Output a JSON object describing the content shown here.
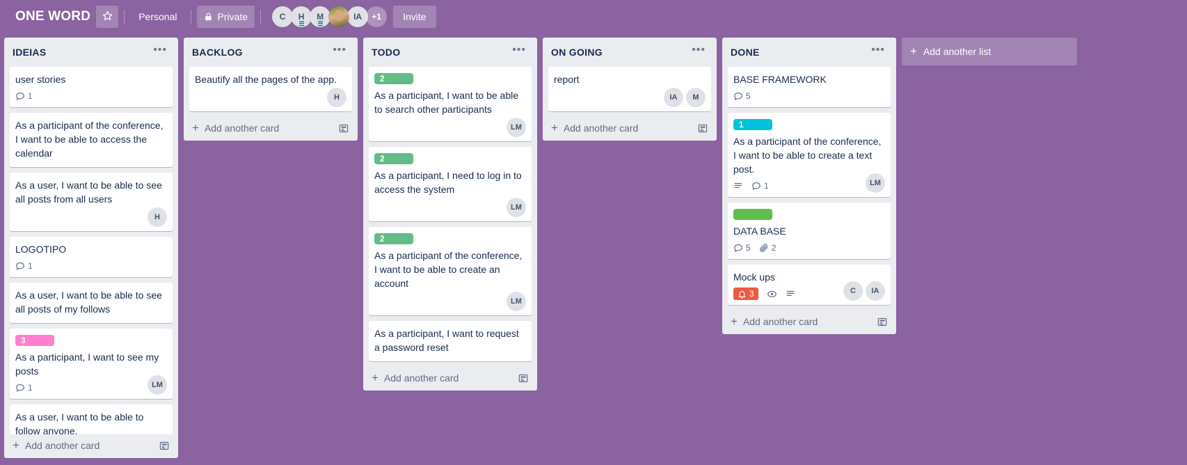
{
  "topbar": {
    "board_title": "ONE WORD",
    "star_icon": "star-icon",
    "workspace": "Personal",
    "visibility": "Private",
    "lock_icon": "lock-icon",
    "invite_label": "Invite",
    "members": [
      {
        "initials": "C",
        "type": "initials",
        "wave": false
      },
      {
        "initials": "H",
        "type": "initials",
        "wave": true
      },
      {
        "initials": "M",
        "type": "initials",
        "wave": true
      },
      {
        "initials": "",
        "type": "photo",
        "wave": false
      },
      {
        "initials": "IA",
        "type": "initials",
        "wave": false
      },
      {
        "initials": "+1",
        "type": "more",
        "wave": false
      }
    ]
  },
  "board": {
    "add_list_label": "Add another list",
    "add_card_label": "Add another card",
    "list_menu_glyph": "•••",
    "lists": [
      {
        "title": "IDEIAS",
        "cards": [
          {
            "title": "user stories",
            "labels": [],
            "comments": "1",
            "members": []
          },
          {
            "title": "As a participant of the conference, I want to be able to access the calendar",
            "labels": [],
            "members": []
          },
          {
            "title": "As a user, I want to be able to see all posts from all users",
            "labels": [],
            "members": [
              "H"
            ]
          },
          {
            "title": "LOGOTIPO",
            "labels": [],
            "comments": "1",
            "members": []
          },
          {
            "title": "As a user, I want to be able to see all posts of my follows",
            "labels": [],
            "members": []
          },
          {
            "title": "As a participant, I want to see my posts",
            "labels": [
              {
                "text": "3",
                "color": "#ff80ce"
              }
            ],
            "comments": "1",
            "members": [
              "LM"
            ]
          },
          {
            "title": "As a user, I want to be able to follow anyone.",
            "labels": [],
            "members": []
          }
        ]
      },
      {
        "title": "BACKLOG",
        "cards": [
          {
            "title": "Beautify all the pages of the app.",
            "labels": [],
            "members": [
              "H"
            ]
          }
        ]
      },
      {
        "title": "TODO",
        "cards": [
          {
            "title": "As a participant, I want to be able to search other participants",
            "labels": [
              {
                "text": "2",
                "color": "#61bd85"
              }
            ],
            "members": [
              "LM"
            ]
          },
          {
            "title": "As a participant, I need to log in to access the system",
            "labels": [
              {
                "text": "2",
                "color": "#61bd85"
              }
            ],
            "members": [
              "LM"
            ]
          },
          {
            "title": "As a participant of the conference, I want to be able to create an account",
            "labels": [
              {
                "text": "2",
                "color": "#61bd85"
              }
            ],
            "members": [
              "LM"
            ]
          },
          {
            "title": "As a participant, I want to request a password reset",
            "labels": [],
            "members": []
          }
        ]
      },
      {
        "title": "ON GOING",
        "cards": [
          {
            "title": "report",
            "labels": [],
            "members": [
              "IA",
              "M"
            ]
          }
        ]
      },
      {
        "title": "DONE",
        "cards": [
          {
            "title": "BASE FRAMEWORK",
            "labels": [],
            "comments": "5",
            "members": []
          },
          {
            "title": "As a participant of the conference, I want to be able to create a text post.",
            "labels": [
              {
                "text": "1",
                "color": "#00c2e0"
              }
            ],
            "description": true,
            "comments": "1",
            "members": [
              "LM"
            ]
          },
          {
            "title": "DATA BASE",
            "labels": [
              {
                "text": "",
                "color": "#61bd4f"
              }
            ],
            "comments": "5",
            "attachments": "2",
            "members": []
          },
          {
            "title": "Mock ups",
            "labels": [],
            "due": "3",
            "watching": true,
            "description": true,
            "members": [
              "C",
              "IA"
            ]
          }
        ]
      }
    ]
  },
  "icons": {
    "comment": "comment-icon",
    "attachment": "attachment-icon",
    "description": "description-icon",
    "watch": "eye-icon",
    "due": "clock-icon",
    "template": "card-template-icon",
    "plus": "plus-icon"
  },
  "colors": {
    "board_bg": "#8a63a0",
    "list_bg": "#ebecf0",
    "card_bg": "#ffffff",
    "text": "#172b4d",
    "muted": "#5e6c84",
    "label_green": "#61bd85",
    "label_pink": "#ff80ce",
    "label_cyan": "#00c2e0",
    "label_solid_green": "#61bd4f",
    "due_red": "#eb5a46"
  }
}
